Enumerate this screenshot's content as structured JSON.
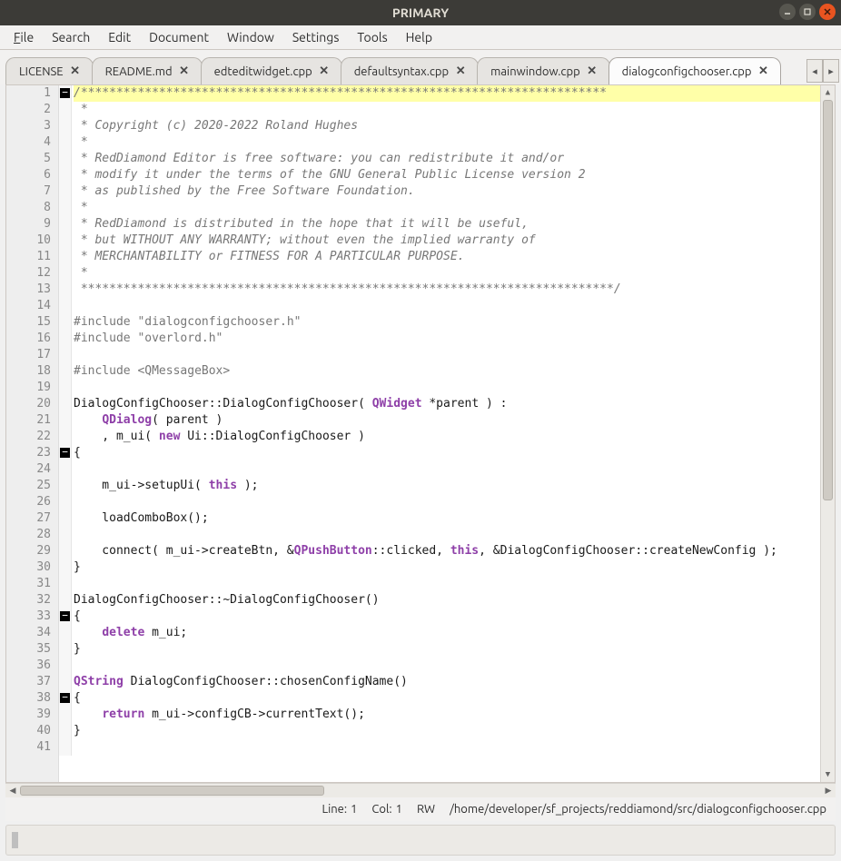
{
  "window": {
    "title": "PRIMARY"
  },
  "menu": {
    "items": [
      {
        "label": "File",
        "mn": "F"
      },
      {
        "label": "Search",
        "mn": ""
      },
      {
        "label": "Edit",
        "mn": ""
      },
      {
        "label": "Document",
        "mn": ""
      },
      {
        "label": "Window",
        "mn": ""
      },
      {
        "label": "Settings",
        "mn": ""
      },
      {
        "label": "Tools",
        "mn": ""
      },
      {
        "label": "Help",
        "mn": ""
      }
    ]
  },
  "tabs": {
    "items": [
      {
        "label": "LICENSE",
        "active": false
      },
      {
        "label": "README.md",
        "active": false
      },
      {
        "label": "edteditwidget.cpp",
        "active": false
      },
      {
        "label": "defaultsyntax.cpp",
        "active": false
      },
      {
        "label": "mainwindow.cpp",
        "active": false
      },
      {
        "label": "dialogconfigchooser.cpp",
        "active": true
      }
    ]
  },
  "editor": {
    "first_line_no": 1,
    "fold_lines": [
      1,
      23,
      33,
      38
    ],
    "lines": [
      {
        "n": 1,
        "hl": true,
        "segs": [
          {
            "c": "c-comment",
            "t": "/**************************************************************************"
          }
        ]
      },
      {
        "n": 2,
        "segs": [
          {
            "c": "c-comment",
            "t": " *"
          }
        ]
      },
      {
        "n": 3,
        "segs": [
          {
            "c": "c-comment",
            "t": " * Copyright (c) 2020-2022 Roland Hughes"
          }
        ]
      },
      {
        "n": 4,
        "segs": [
          {
            "c": "c-comment",
            "t": " *"
          }
        ]
      },
      {
        "n": 5,
        "segs": [
          {
            "c": "c-comment",
            "t": " * RedDiamond Editor is free software: you can redistribute it and/or"
          }
        ]
      },
      {
        "n": 6,
        "segs": [
          {
            "c": "c-comment",
            "t": " * modify it under the terms of the GNU General Public License version 2"
          }
        ]
      },
      {
        "n": 7,
        "segs": [
          {
            "c": "c-comment",
            "t": " * as published by the Free Software Foundation."
          }
        ]
      },
      {
        "n": 8,
        "segs": [
          {
            "c": "c-comment",
            "t": " *"
          }
        ]
      },
      {
        "n": 9,
        "segs": [
          {
            "c": "c-comment",
            "t": " * RedDiamond is distributed in the hope that it will be useful,"
          }
        ]
      },
      {
        "n": 10,
        "segs": [
          {
            "c": "c-comment",
            "t": " * but WITHOUT ANY WARRANTY; without even the implied warranty of"
          }
        ]
      },
      {
        "n": 11,
        "segs": [
          {
            "c": "c-comment",
            "t": " * MERCHANTABILITY or FITNESS FOR A PARTICULAR PURPOSE."
          }
        ]
      },
      {
        "n": 12,
        "segs": [
          {
            "c": "c-comment",
            "t": " *"
          }
        ]
      },
      {
        "n": 13,
        "segs": [
          {
            "c": "c-comment",
            "t": " ***************************************************************************/"
          }
        ]
      },
      {
        "n": 14,
        "segs": [
          {
            "c": "",
            "t": ""
          }
        ]
      },
      {
        "n": 15,
        "segs": [
          {
            "c": "c-pre",
            "t": "#include "
          },
          {
            "c": "c-str",
            "t": "\"dialogconfigchooser.h\""
          }
        ]
      },
      {
        "n": 16,
        "segs": [
          {
            "c": "c-pre",
            "t": "#include "
          },
          {
            "c": "c-str",
            "t": "\"overlord.h\""
          }
        ]
      },
      {
        "n": 17,
        "segs": [
          {
            "c": "",
            "t": ""
          }
        ]
      },
      {
        "n": 18,
        "segs": [
          {
            "c": "c-pre",
            "t": "#include "
          },
          {
            "c": "c-str",
            "t": "<QMessageBox>"
          }
        ]
      },
      {
        "n": 19,
        "segs": [
          {
            "c": "",
            "t": ""
          }
        ]
      },
      {
        "n": 20,
        "segs": [
          {
            "c": "",
            "t": "DialogConfigChooser::DialogConfigChooser( "
          },
          {
            "c": "c-type",
            "t": "QWidget"
          },
          {
            "c": "",
            "t": " *parent ) :"
          }
        ]
      },
      {
        "n": 21,
        "segs": [
          {
            "c": "",
            "t": "    "
          },
          {
            "c": "c-type",
            "t": "QDialog"
          },
          {
            "c": "",
            "t": "( parent )"
          }
        ]
      },
      {
        "n": 22,
        "segs": [
          {
            "c": "",
            "t": "    , m_ui( "
          },
          {
            "c": "c-kw",
            "t": "new"
          },
          {
            "c": "",
            "t": " Ui::DialogConfigChooser )"
          }
        ]
      },
      {
        "n": 23,
        "segs": [
          {
            "c": "",
            "t": "{"
          }
        ]
      },
      {
        "n": 24,
        "segs": [
          {
            "c": "",
            "t": ""
          }
        ]
      },
      {
        "n": 25,
        "segs": [
          {
            "c": "",
            "t": "    m_ui->setupUi( "
          },
          {
            "c": "c-kw",
            "t": "this"
          },
          {
            "c": "",
            "t": " );"
          }
        ]
      },
      {
        "n": 26,
        "segs": [
          {
            "c": "",
            "t": ""
          }
        ]
      },
      {
        "n": 27,
        "segs": [
          {
            "c": "",
            "t": "    loadComboBox();"
          }
        ]
      },
      {
        "n": 28,
        "segs": [
          {
            "c": "",
            "t": ""
          }
        ]
      },
      {
        "n": 29,
        "segs": [
          {
            "c": "",
            "t": "    connect( m_ui->createBtn, &"
          },
          {
            "c": "c-type",
            "t": "QPushButton"
          },
          {
            "c": "",
            "t": "::clicked, "
          },
          {
            "c": "c-kw",
            "t": "this"
          },
          {
            "c": "",
            "t": ", &DialogConfigChooser::createNewConfig );"
          }
        ]
      },
      {
        "n": 30,
        "segs": [
          {
            "c": "",
            "t": "}"
          }
        ]
      },
      {
        "n": 31,
        "segs": [
          {
            "c": "",
            "t": ""
          }
        ]
      },
      {
        "n": 32,
        "segs": [
          {
            "c": "",
            "t": "DialogConfigChooser::~DialogConfigChooser()"
          }
        ]
      },
      {
        "n": 33,
        "segs": [
          {
            "c": "",
            "t": "{"
          }
        ]
      },
      {
        "n": 34,
        "segs": [
          {
            "c": "",
            "t": "    "
          },
          {
            "c": "c-kw",
            "t": "delete"
          },
          {
            "c": "",
            "t": " m_ui;"
          }
        ]
      },
      {
        "n": 35,
        "segs": [
          {
            "c": "",
            "t": "}"
          }
        ]
      },
      {
        "n": 36,
        "segs": [
          {
            "c": "",
            "t": ""
          }
        ]
      },
      {
        "n": 37,
        "segs": [
          {
            "c": "c-type",
            "t": "QString"
          },
          {
            "c": "",
            "t": " DialogConfigChooser::chosenConfigName()"
          }
        ]
      },
      {
        "n": 38,
        "segs": [
          {
            "c": "",
            "t": "{"
          }
        ]
      },
      {
        "n": 39,
        "segs": [
          {
            "c": "",
            "t": "    "
          },
          {
            "c": "c-kw",
            "t": "return"
          },
          {
            "c": "",
            "t": " m_ui->configCB->currentText();"
          }
        ]
      },
      {
        "n": 40,
        "segs": [
          {
            "c": "",
            "t": "}"
          }
        ]
      },
      {
        "n": 41,
        "segs": [
          {
            "c": "",
            "t": ""
          }
        ]
      }
    ]
  },
  "status": {
    "line_label": "Line:",
    "line": "1",
    "col_label": "Col:",
    "col": "1",
    "mode": "RW",
    "path": "/home/developer/sf_projects/reddiamond/src/dialogconfigchooser.cpp"
  }
}
